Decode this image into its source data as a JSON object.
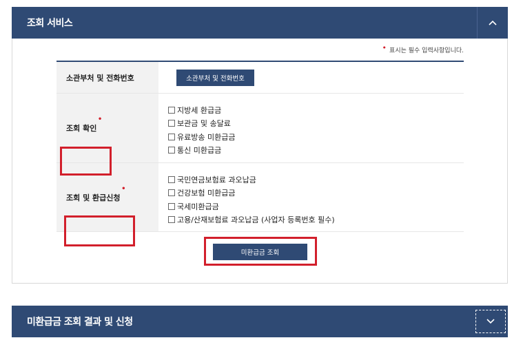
{
  "service_panel": {
    "title": "조회 서비스",
    "toggle_icon": "chevron-up-icon",
    "required_note": "표시는 필수 입력사항입니다.",
    "rows": {
      "dept": {
        "label": "소관부처 및 전화번호",
        "button": "소관부처 및 전화번호"
      },
      "inquiry": {
        "label": "조회 확인",
        "options": [
          "지방세 환급금",
          "보관금 및 송달료",
          "유료방송 미환급금",
          "통신 미환급금"
        ]
      },
      "inquiry_refund": {
        "label": "조회 및 환급신청",
        "options": [
          "국민연금보험료 과오납금",
          "건강보험 미환급금",
          "국세미환급금",
          "고용/산재보험료 과오납금 (사업자 등록번호 필수)"
        ]
      }
    },
    "search_button": "미환급금 조회"
  },
  "result_panel": {
    "title": "미환급금 조회 결과 및 신청",
    "toggle_icon": "chevron-down-icon"
  },
  "colors": {
    "header_bg": "#2f4a74",
    "highlight": "#d21f2b"
  }
}
